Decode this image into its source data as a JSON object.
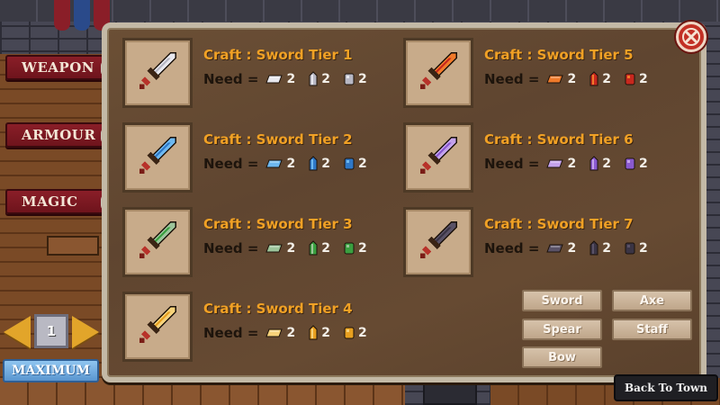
{
  "side_tabs": {
    "weapon": "WEAPON",
    "armour": "ARMOUR",
    "magic": "MAGIC"
  },
  "quantity": {
    "value": "1",
    "maximum_label": "MAXIMUM"
  },
  "need_label": "Need =",
  "recipes": [
    {
      "title": "Craft : Sword Tier 1",
      "color": "#e8e8ee",
      "accent": "#b8b8c4",
      "materials": [
        {
          "icon": "ingot-icon",
          "qty": "2"
        },
        {
          "icon": "crystal-icon",
          "qty": "2"
        },
        {
          "icon": "gem-icon",
          "qty": "2"
        }
      ]
    },
    {
      "title": "Craft : Sword Tier 2",
      "color": "#6db8f0",
      "accent": "#2f78c8",
      "materials": [
        {
          "icon": "ingot-icon",
          "qty": "2"
        },
        {
          "icon": "crystal-icon",
          "qty": "2"
        },
        {
          "icon": "gem-icon",
          "qty": "2"
        }
      ]
    },
    {
      "title": "Craft : Sword Tier 3",
      "color": "#9cc49a",
      "accent": "#3aa040",
      "materials": [
        {
          "icon": "ingot-icon",
          "qty": "2"
        },
        {
          "icon": "crystal-icon",
          "qty": "2"
        },
        {
          "icon": "gem-icon",
          "qty": "2"
        }
      ]
    },
    {
      "title": "Craft : Sword Tier 4",
      "color": "#f6d27a",
      "accent": "#e8a020",
      "materials": [
        {
          "icon": "ingot-icon",
          "qty": "2"
        },
        {
          "icon": "crystal-icon",
          "qty": "2"
        },
        {
          "icon": "gem-icon",
          "qty": "2"
        }
      ]
    },
    {
      "title": "Craft : Sword Tier 5",
      "color": "#f07a2a",
      "accent": "#c8281e",
      "materials": [
        {
          "icon": "ingot-icon",
          "qty": "2"
        },
        {
          "icon": "crystal-icon",
          "qty": "2"
        },
        {
          "icon": "gem-icon",
          "qty": "2"
        }
      ]
    },
    {
      "title": "Craft : Sword Tier 6",
      "color": "#c4a2ec",
      "accent": "#8a5ad0",
      "materials": [
        {
          "icon": "ingot-icon",
          "qty": "2"
        },
        {
          "icon": "crystal-icon",
          "qty": "2"
        },
        {
          "icon": "gem-icon",
          "qty": "2"
        }
      ]
    },
    {
      "title": "Craft : Sword Tier 7",
      "color": "#5a5266",
      "accent": "#3a3444",
      "materials": [
        {
          "icon": "ingot-icon",
          "qty": "2"
        },
        {
          "icon": "crystal-icon",
          "qty": "2"
        },
        {
          "icon": "gem-icon",
          "qty": "2"
        }
      ]
    }
  ],
  "categories": [
    "Sword",
    "Axe",
    "Spear",
    "Staff",
    "Bow"
  ],
  "back_button": "Back To Town",
  "close_icon": "close-icon"
}
